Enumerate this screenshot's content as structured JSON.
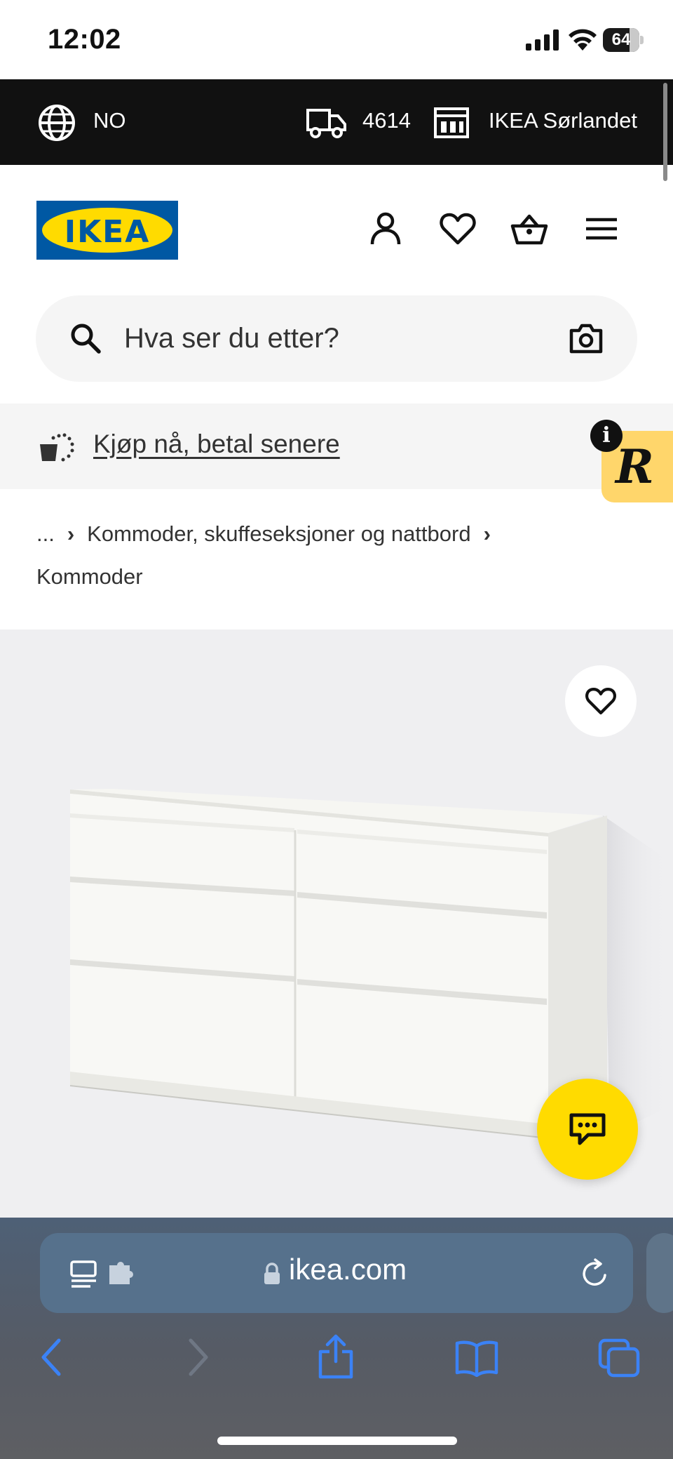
{
  "status_bar": {
    "time": "12:02",
    "battery": "64"
  },
  "top_bar": {
    "country": "NO",
    "postcode": "4614",
    "store": "IKEA Sørlandet"
  },
  "header": {
    "logo": "IKEA",
    "icons": [
      "user-icon",
      "heart-icon",
      "shopping-bag-icon",
      "menu-icon"
    ]
  },
  "search": {
    "placeholder": "Hva ser du etter?"
  },
  "promo": {
    "text": "Kjøp nå, betal senere"
  },
  "widget": {
    "letter": "R",
    "info": "i"
  },
  "breadcrumb": {
    "ellipsis": "...",
    "category": "Kommoder, skuffeseksjoner og nattbord",
    "current": "Kommoder"
  },
  "safari": {
    "url": "ikea.com"
  },
  "colors": {
    "ikea_blue": "#0058a3",
    "ikea_yellow": "#ffdb00",
    "safari_blue": "#3b82f6"
  }
}
